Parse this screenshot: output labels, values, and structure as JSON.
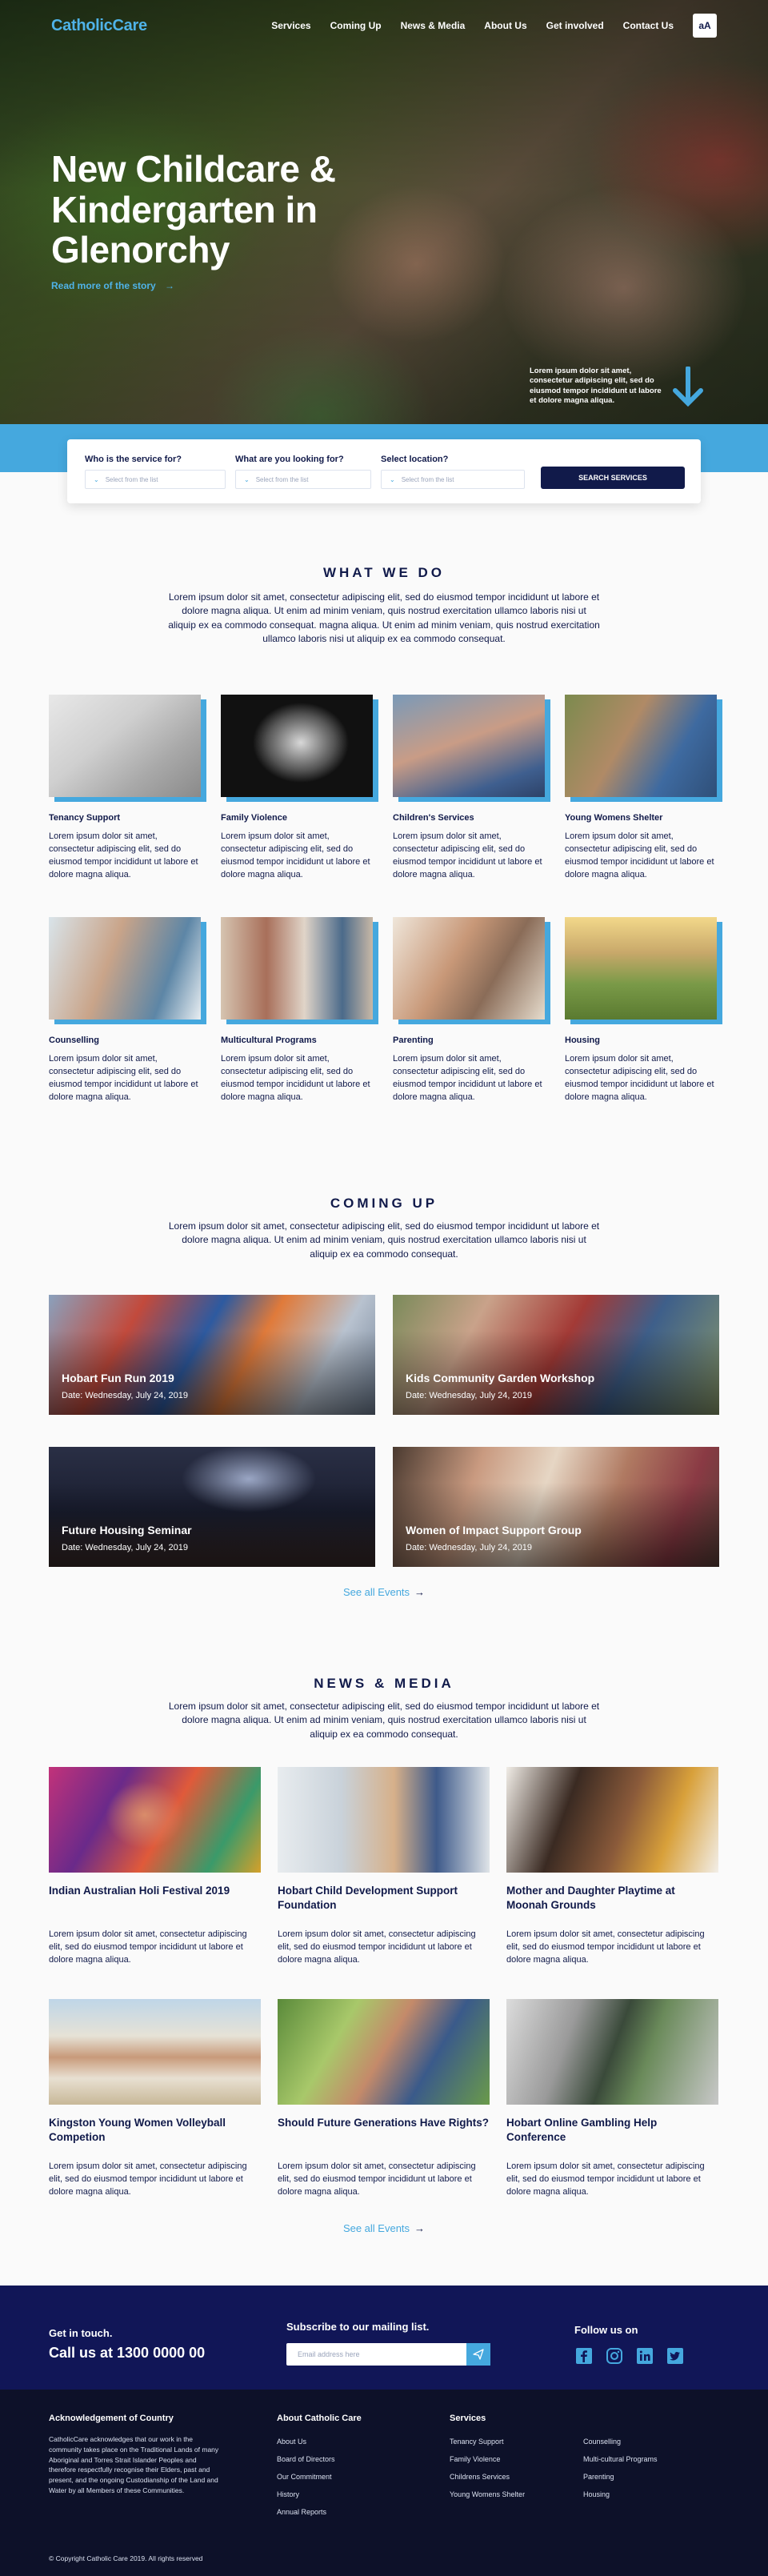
{
  "nav": {
    "logo": "CatholicCare",
    "links": [
      "Services",
      "Coming Up",
      "News & Media",
      "About Us",
      "Get involved",
      "Contact Us"
    ],
    "font_toggle": "aA"
  },
  "hero": {
    "title": "New Childcare & Kindergarten in Glenorchy",
    "link": "Read more of the story",
    "caption": "Lorem ipsum dolor sit amet, consectetur adipiscing elit, sed do eiusmod tempor incididunt ut labore et dolore magna aliqua."
  },
  "search": {
    "fields": [
      {
        "label": "Who is the service for?",
        "placeholder": "Select from the list"
      },
      {
        "label": "What are you looking for?",
        "placeholder": "Select from the list"
      },
      {
        "label": "Select location?",
        "placeholder": "Select from the list"
      }
    ],
    "button": "SEARCH SERVICES"
  },
  "what_we_do": {
    "title": "WHAT WE DO",
    "intro": "Lorem ipsum dolor sit amet, consectetur adipiscing elit, sed do eiusmod tempor incididunt ut labore et dolore magna aliqua. Ut enim ad minim veniam, quis nostrud exercitation ullamco laboris nisi ut aliquip ex ea commodo consequat.  magna aliqua. Ut enim ad minim veniam, quis nostrud exercitation ullamco laboris nisi ut aliquip ex ea commodo consequat.",
    "services": [
      {
        "title": "Tenancy Support",
        "desc": "Lorem ipsum dolor sit amet, consectetur adipiscing elit, sed do eiusmod tempor incididunt ut labore et dolore magna aliqua."
      },
      {
        "title": "Family Violence",
        "desc": "Lorem ipsum dolor sit amet, consectetur adipiscing elit, sed do eiusmod tempor incididunt ut labore et dolore magna aliqua."
      },
      {
        "title": "Children's Services",
        "desc": "Lorem ipsum dolor sit amet, consectetur adipiscing elit, sed do eiusmod tempor incididunt ut labore et dolore magna aliqua."
      },
      {
        "title": "Young Womens Shelter",
        "desc": "Lorem ipsum dolor sit amet, consectetur adipiscing elit, sed do eiusmod tempor incididunt ut labore et dolore magna aliqua."
      },
      {
        "title": "Counselling",
        "desc": "Lorem ipsum dolor sit amet, consectetur adipiscing elit, sed do eiusmod tempor incididunt ut labore et dolore magna aliqua."
      },
      {
        "title": "Multicultural Programs",
        "desc": "Lorem ipsum dolor sit amet, consectetur adipiscing elit, sed do eiusmod tempor incididunt ut labore et dolore magna aliqua."
      },
      {
        "title": "Parenting",
        "desc": "Lorem ipsum dolor sit amet, consectetur adipiscing elit, sed do eiusmod tempor incididunt ut labore et dolore magna aliqua."
      },
      {
        "title": "Housing",
        "desc": "Lorem ipsum dolor sit amet, consectetur adipiscing elit, sed do eiusmod tempor incididunt ut labore et dolore magna aliqua."
      }
    ]
  },
  "coming_up": {
    "title": "COMING UP",
    "intro": "Lorem ipsum dolor sit amet, consectetur adipiscing elit, sed do eiusmod tempor incididunt ut labore et dolore magna aliqua. Ut enim ad minim veniam, quis nostrud exercitation ullamco laboris nisi ut aliquip ex ea commodo consequat.",
    "events": [
      {
        "title": "Hobart Fun Run 2019",
        "date": "Date: Wednesday, July 24, 2019"
      },
      {
        "title": "Kids Community Garden Workshop",
        "date": "Date: Wednesday, July 24, 2019"
      },
      {
        "title": "Future Housing Seminar",
        "date": "Date: Wednesday, July 24, 2019"
      },
      {
        "title": "Women of Impact Support Group",
        "date": "Date: Wednesday, July 24, 2019"
      }
    ],
    "see_all": "See all Events"
  },
  "news": {
    "title": "NEWS & MEDIA",
    "intro": "Lorem ipsum dolor sit amet, consectetur adipiscing elit, sed do eiusmod tempor incididunt ut labore et dolore magna aliqua. Ut enim ad minim veniam, quis nostrud exercitation ullamco laboris nisi ut aliquip ex ea commodo consequat.",
    "items": [
      {
        "title": "Indian Australian Holi Festival 2019",
        "desc": "Lorem ipsum dolor sit amet, consectetur adipiscing elit, sed do eiusmod tempor incididunt ut labore et dolore magna aliqua."
      },
      {
        "title": "Hobart Child Development Support Foundation",
        "desc": "Lorem ipsum dolor sit amet, consectetur adipiscing elit, sed do eiusmod tempor incididunt ut labore et dolore magna aliqua."
      },
      {
        "title": "Mother and Daughter Playtime at Moonah Grounds",
        "desc": "Lorem ipsum dolor sit amet, consectetur adipiscing elit, sed do eiusmod tempor incididunt ut labore et dolore magna aliqua."
      },
      {
        "title": "Kingston Young Women Volleyball Competion",
        "desc": "Lorem ipsum dolor sit amet, consectetur adipiscing elit, sed do eiusmod tempor incididunt ut labore et dolore magna aliqua."
      },
      {
        "title": "Should Future Generations Have Rights?",
        "desc": "Lorem ipsum dolor sit amet, consectetur adipiscing elit, sed do eiusmod tempor incididunt ut labore et dolore magna aliqua."
      },
      {
        "title": "Hobart Online Gambling Help Conference",
        "desc": "Lorem ipsum dolor sit amet, consectetur adipiscing elit, sed do eiusmod tempor incididunt ut labore et dolore magna aliqua."
      }
    ],
    "see_all": "See all Events"
  },
  "contact": {
    "get_in_touch": "Get in touch.",
    "phone": "Call us at 1300 0000 00",
    "subscribe": "Subscribe to our mailing list.",
    "email_placeholder": "Email address here",
    "follow": "Follow us on",
    "social_icons": [
      "facebook-icon",
      "instagram-icon",
      "linkedin-icon",
      "twitter-icon"
    ]
  },
  "footer": {
    "ack_title": "Acknowledgement of Country",
    "ack_text": "CatholicCare acknowledges that our work in the community takes place on the Traditional Lands of many Aboriginal and Torres Strait Islander Peoples and therefore respectfully recognise their Elders, past and present, and the ongoing Custodianship of the Land and Water by all Members of these Communities.",
    "about_title": "About Catholic Care",
    "about_links": [
      "About Us",
      "Board of Directors",
      "Our Commitment",
      "History",
      "Annual Reports"
    ],
    "services_title": "Services",
    "services_col1": [
      "Tenancy Support",
      "Family Violence",
      "Childrens Services",
      "Young Womens Shelter"
    ],
    "services_col2": [
      "Counselling",
      "Multi-cultural Programs",
      "Parenting",
      "Housing"
    ],
    "copyright": "© Copyright Catholic Care 2019. All rights reserved"
  },
  "colors": {
    "navy": "#111a4a",
    "accent": "#45a8de",
    "footer_bg": "#0d1129",
    "contact_bg": "#111657"
  }
}
